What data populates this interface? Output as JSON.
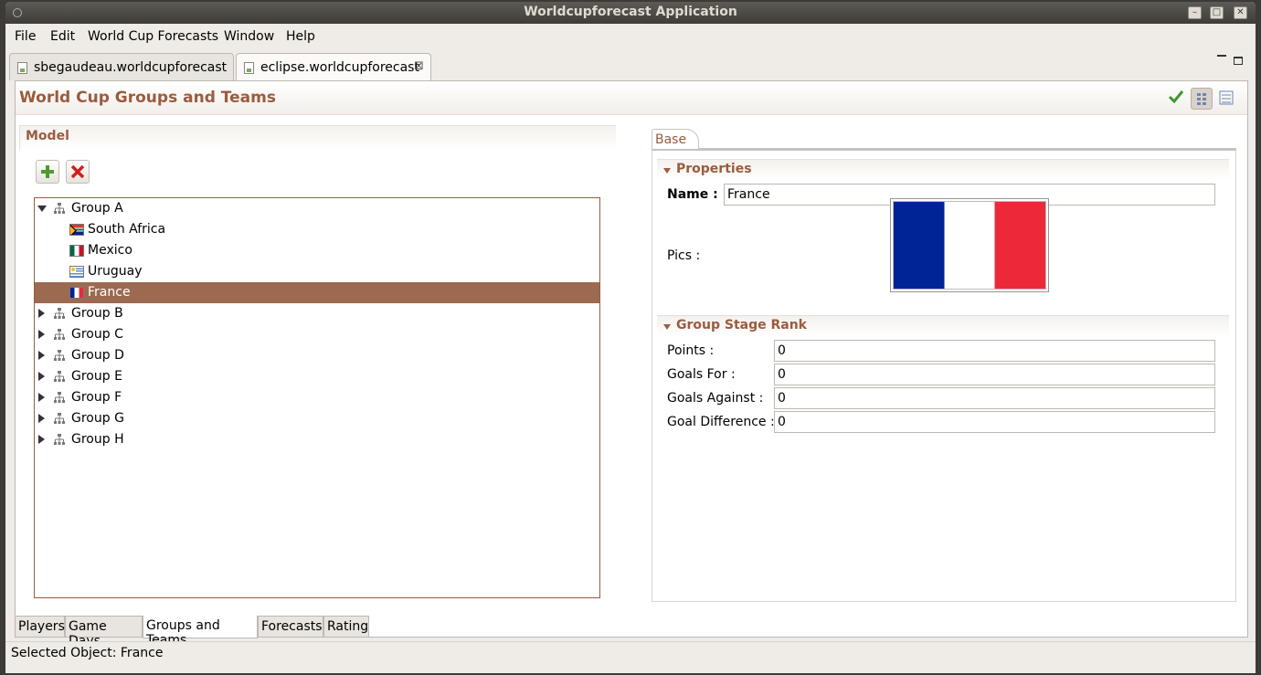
{
  "window": {
    "title": "Worldcupforecast Application"
  },
  "menu": [
    "File",
    "Edit",
    "World Cup Forecasts",
    "Window",
    "Help"
  ],
  "editor_tabs": [
    {
      "label": "sbegaudeau.worldcupforecast",
      "active": false
    },
    {
      "label": "eclipse.worldcupforecast",
      "active": true
    }
  ],
  "form": {
    "title": "World Cup Groups and Teams"
  },
  "model": {
    "title": "Model",
    "tree": [
      {
        "label": "Group A",
        "expanded": true,
        "children": [
          {
            "label": "South Africa",
            "flag": "south-africa"
          },
          {
            "label": "Mexico",
            "flag": "mexico"
          },
          {
            "label": "Uruguay",
            "flag": "uruguay"
          },
          {
            "label": "France",
            "flag": "france",
            "selected": true
          }
        ]
      },
      {
        "label": "Group B"
      },
      {
        "label": "Group C"
      },
      {
        "label": "Group D"
      },
      {
        "label": "Group E"
      },
      {
        "label": "Group F"
      },
      {
        "label": "Group G"
      },
      {
        "label": "Group H"
      }
    ]
  },
  "details": {
    "tab": "Base",
    "properties": {
      "title": "Properties",
      "name_label": "Name :",
      "name_value": "France",
      "pics_label": "Pics :"
    },
    "rank": {
      "title": "Group Stage Rank",
      "fields": [
        {
          "label": "Points :",
          "value": "0"
        },
        {
          "label": "Goals For :",
          "value": "0"
        },
        {
          "label": "Goals Against :",
          "value": "0"
        },
        {
          "label": "Goal Difference :",
          "value": "0"
        }
      ]
    }
  },
  "page_tabs": [
    {
      "label": "Players",
      "active": false
    },
    {
      "label": "Game Days",
      "active": false
    },
    {
      "label": "Groups and Teams",
      "active": true
    },
    {
      "label": "Forecasts",
      "active": false
    },
    {
      "label": "Rating",
      "active": false
    }
  ],
  "status": {
    "text": "Selected Object: France"
  },
  "colors": {
    "accent": "#9c5b3e",
    "selection": "#9c6a50"
  }
}
